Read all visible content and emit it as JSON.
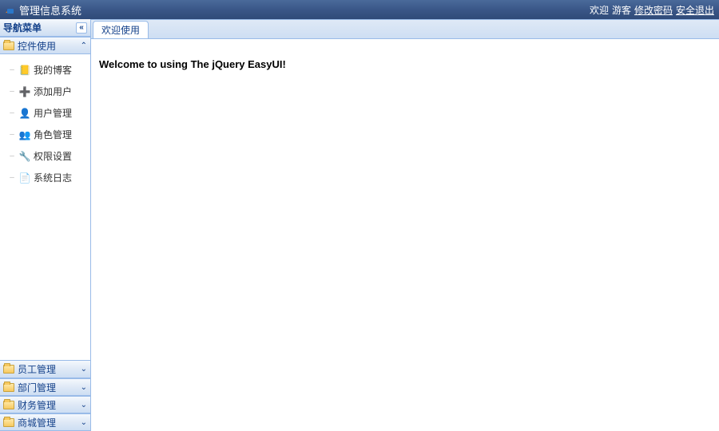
{
  "header": {
    "title": "管理信息系统",
    "welcome_prefix": "欢迎",
    "user": "游客",
    "change_pw": "修改密码",
    "logout": "安全退出"
  },
  "sidebar": {
    "nav_title": "导航菜单",
    "collapse_glyph": "«",
    "sections": [
      {
        "label": "控件使用",
        "expanded": true,
        "chev": "⌃",
        "items": [
          {
            "icon": "📒",
            "icon_name": "blog-icon",
            "label": "我的博客"
          },
          {
            "icon": "➕",
            "icon_name": "add-user-icon",
            "label": "添加用户"
          },
          {
            "icon": "👤",
            "icon_name": "user-icon",
            "label": "用户管理"
          },
          {
            "icon": "👥",
            "icon_name": "role-icon",
            "label": "角色管理"
          },
          {
            "icon": "🔧",
            "icon_name": "perm-icon",
            "label": "权限设置"
          },
          {
            "icon": "📄",
            "icon_name": "log-icon",
            "label": "系统日志"
          }
        ]
      },
      {
        "label": "员工管理",
        "expanded": false,
        "chev": "⌄"
      },
      {
        "label": "部门管理",
        "expanded": false,
        "chev": "⌄"
      },
      {
        "label": "财务管理",
        "expanded": false,
        "chev": "⌄"
      },
      {
        "label": "商城管理",
        "expanded": false,
        "chev": "⌄"
      }
    ]
  },
  "main": {
    "tab_label": "欢迎使用",
    "welcome_text": "Welcome to using The jQuery EasyUI!"
  }
}
